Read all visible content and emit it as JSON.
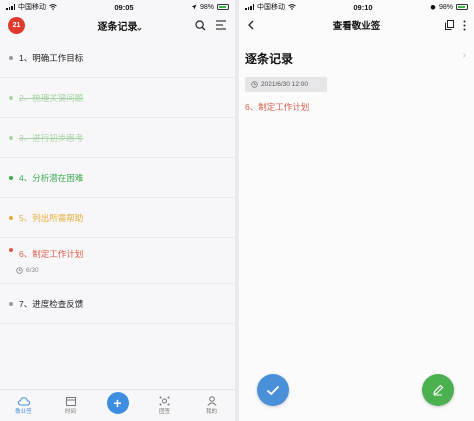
{
  "left": {
    "status": {
      "carrier": "中国移动",
      "time": "09:05",
      "battery": "98%"
    },
    "header": {
      "logo": "21",
      "title": "逐条记录"
    },
    "items": [
      {
        "label": "1、明确工作目标",
        "color": "#222222",
        "dot": "#9a9a9a",
        "strike": false
      },
      {
        "label": "2、梳理关键问题",
        "color": "#a9d4a5",
        "dot": "#a9d4a5",
        "strike": true
      },
      {
        "label": "3、进行初步思考",
        "color": "#a9d4a5",
        "dot": "#a9d4a5",
        "strike": true
      },
      {
        "label": "4、分析潜在困难",
        "color": "#3faa4e",
        "dot": "#3faa4e",
        "strike": false
      },
      {
        "label": "5、列出所需帮助",
        "color": "#e6ad3a",
        "dot": "#e6ad3a",
        "strike": false
      },
      {
        "label": "6、制定工作计划",
        "color": "#d95c4a",
        "dot": "#d95c4a",
        "strike": false,
        "meta": "6/30"
      },
      {
        "label": "7、进度检查反馈",
        "color": "#222222",
        "dot": "#9a9a9a",
        "strike": false
      }
    ],
    "tabs": [
      {
        "label": "敬业签",
        "icon": "cloud-icon",
        "active": true
      },
      {
        "label": "时间",
        "icon": "calendar-icon",
        "active": false
      },
      {
        "label": "+",
        "icon": "plus-icon",
        "active": false
      },
      {
        "label": "团签",
        "icon": "team-icon",
        "active": false
      },
      {
        "label": "我的",
        "icon": "person-icon",
        "active": false
      }
    ]
  },
  "right": {
    "status": {
      "carrier": "中国移动",
      "time": "09:10",
      "battery": "98%"
    },
    "header": {
      "title": "查看敬业签"
    },
    "detail": {
      "title": "逐条记录",
      "date": "2021/6/30 12:00",
      "item": "6、制定工作计划"
    }
  },
  "colors": {
    "accent_blue": "#4a90d9",
    "accent_green": "#4caf50",
    "red": "#d95c4a"
  }
}
